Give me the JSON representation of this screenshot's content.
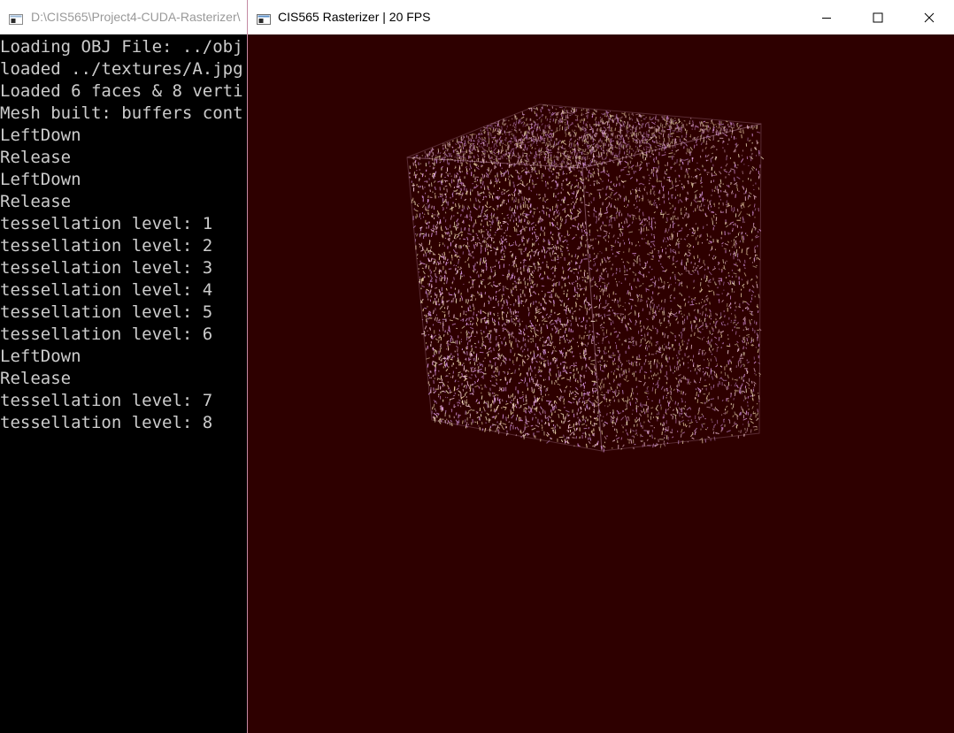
{
  "console": {
    "title": "D:\\CIS565\\Project4-CUDA-Rasterizer\\",
    "icon": "console-icon",
    "text_color": "#cccccc",
    "lines": [
      "Loading OBJ File: ../obj",
      "loaded ../textures/A.jpg",
      "Loaded 6 faces & 8 verti",
      "Mesh built: buffers cont",
      "LeftDown",
      "Release",
      "LeftDown",
      "Release",
      "tessellation level: 1",
      "tessellation level: 2",
      "tessellation level: 3",
      "tessellation level: 4",
      "tessellation level: 5",
      "tessellation level: 6",
      "LeftDown",
      "Release",
      "tessellation level: 7",
      "tessellation level: 8"
    ]
  },
  "rasterizer": {
    "title": "CIS565 Rasterizer | 20 FPS",
    "icon": "window-icon",
    "background_color": "#2e0000",
    "controls": {
      "minimize_icon": "minimize-icon",
      "maximize_icon": "maximize-icon",
      "close_icon": "close-icon"
    },
    "scene": {
      "object": "cube",
      "point_colors": [
        "#ffe6b8",
        "#f0a8ff",
        "#ffd0e6",
        "#c890d8",
        "#fff2cc"
      ]
    }
  }
}
